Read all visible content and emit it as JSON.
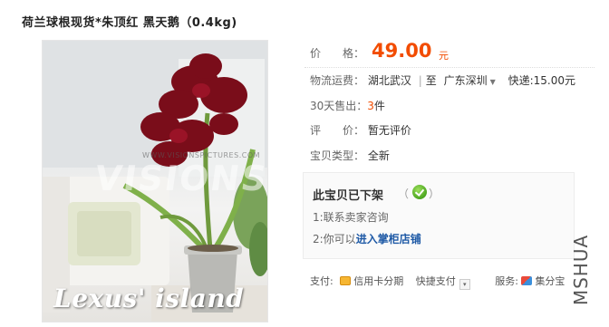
{
  "title": "荷兰球根现货*朱顶红  黑天鹅（0.4kg)",
  "image": {
    "watermark_url": "WWW.VISIONSPICTURES.COM",
    "watermark_brand": "VISIONS",
    "shop_watermark": "Lexus' island"
  },
  "price": {
    "label": "价　　格：",
    "value": "49.00",
    "unit": "元"
  },
  "shipping": {
    "label": "物流运费：",
    "from": "湖北武汉",
    "separator": "|",
    "to_prefix": "至",
    "to": "广东深圳",
    "express": "快递:15.00元"
  },
  "sales": {
    "label": "30天售出：",
    "count": "3",
    "unit": "件"
  },
  "review": {
    "label": "评　　价：",
    "value": "暂无评价"
  },
  "type": {
    "label": "宝贝类型：",
    "value": "全新"
  },
  "offshelf": {
    "title": "此宝贝已下架",
    "paren_open": "（",
    "paren_close": "）",
    "step1": "1:联系卖家咨询",
    "step2_prefix": "2:你可以",
    "step2_link": "进入掌柜店铺"
  },
  "payment": {
    "label": "支付:",
    "credit": "信用卡分期",
    "quick": "快捷支付",
    "service_label": "服务:",
    "service": "集分宝"
  },
  "side_watermark": "MSHUA",
  "colors": {
    "price": "#f24c00",
    "link": "#1f5aa6",
    "ok": "#4aa51f"
  }
}
